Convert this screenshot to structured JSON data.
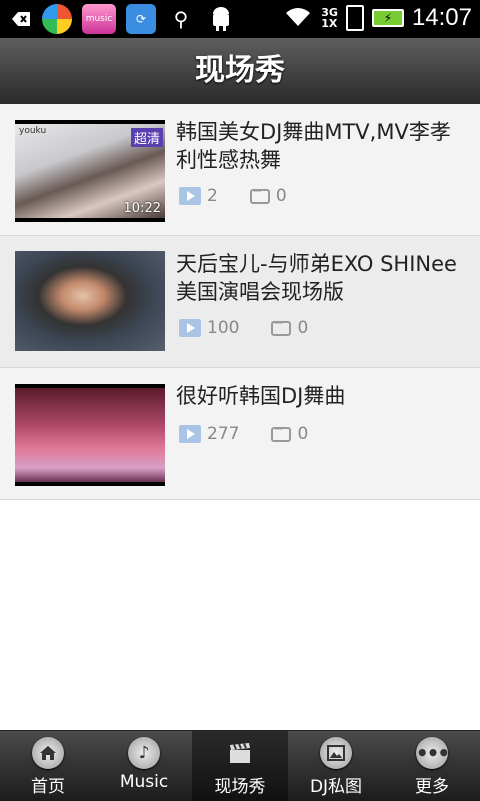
{
  "status_bar": {
    "time": "14:07",
    "network_top": "3G",
    "network_bottom": "1X",
    "icons": [
      "back-icon",
      "colorwheel-icon",
      "music-app-icon",
      "sync-icon",
      "usb-icon",
      "android-icon"
    ]
  },
  "header": {
    "title": "现场秀"
  },
  "videos": [
    {
      "title": "韩国美女DJ舞曲MTV,MV李孝利性感热舞",
      "plays": "2",
      "comments": "0",
      "badge": "超清",
      "duration": "10:22",
      "logo": "youku"
    },
    {
      "title": "天后宝儿-与师弟EXO SHINee美国演唱会现场版",
      "plays": "100",
      "comments": "0"
    },
    {
      "title": "很好听韩国DJ舞曲",
      "plays": "277",
      "comments": "0"
    }
  ],
  "nav": {
    "items": [
      {
        "label": "首页",
        "icon": "home-icon"
      },
      {
        "label": "Music",
        "icon": "music-note-icon"
      },
      {
        "label": "现场秀",
        "icon": "clapperboard-icon",
        "active": true
      },
      {
        "label": "DJ私图",
        "icon": "picture-icon"
      },
      {
        "label": "更多",
        "icon": "more-icon"
      }
    ]
  }
}
